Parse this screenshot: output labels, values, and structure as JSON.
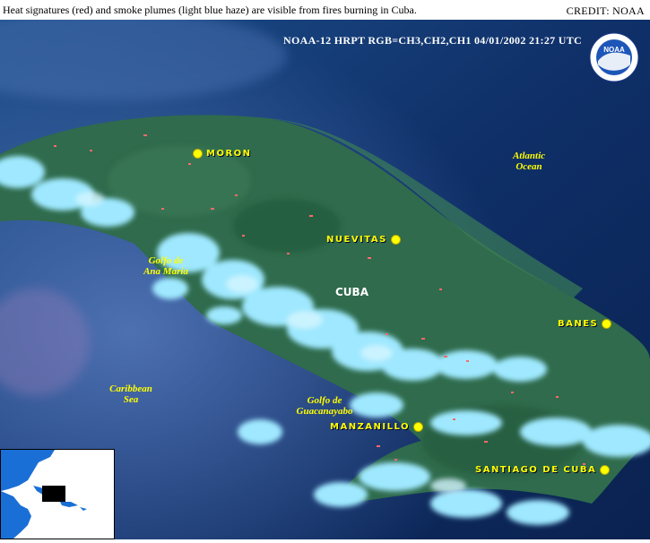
{
  "caption": "Heat signatures (red) and smoke plumes (light blue haze) are visible from fires burning in Cuba.",
  "credit": "CREDIT: NOAA",
  "satellite_info": "NOAA-12  HRPT  RGB=CH3,CH2,CH1  04/01/2002  21:27 UTC",
  "logo": {
    "text": "NOAA",
    "icon": "noaa-logo"
  },
  "country_label": "CUBA",
  "cities": [
    {
      "name": "Moron"
    },
    {
      "name": "Nuevitas"
    },
    {
      "name": "Banes"
    },
    {
      "name": "Manzanillo"
    },
    {
      "name": "Santiago de Cuba"
    }
  ],
  "water_bodies": [
    {
      "line1": "Atlantic",
      "line2": "Ocean"
    },
    {
      "line1": "Golfo de",
      "line2": "Ana Maria"
    },
    {
      "line1": "Caribbean",
      "line2": "Sea"
    },
    {
      "line1": "Golfo de",
      "line2": "Guacanayabo"
    }
  ],
  "colors": {
    "ocean": "#0d2a5e",
    "land": "#2d6b4a",
    "cloud": "#9fe8ff",
    "fire": "#ff6060",
    "city_marker": "#ffff00"
  }
}
